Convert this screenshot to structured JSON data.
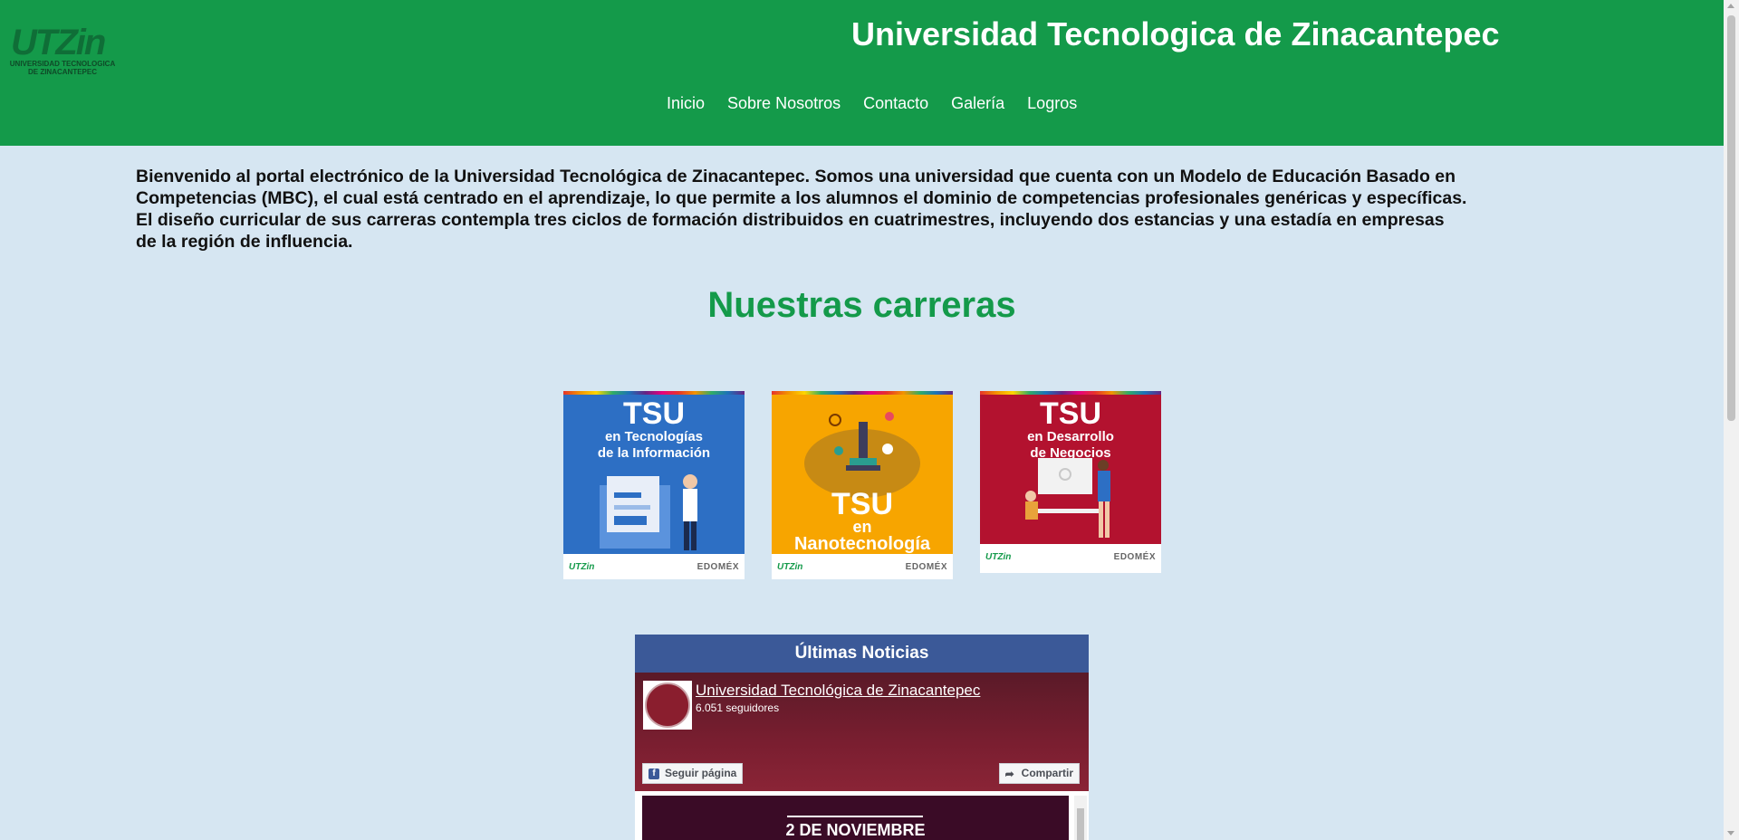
{
  "header": {
    "logo_text": "UTZin",
    "logo_subtitle": "UNIVERSIDAD TECNOLOGICA DE ZINACANTEPEC",
    "title": "Universidad Tecnologica de Zinacantepec",
    "nav": [
      "Inicio",
      "Sobre Nosotros",
      "Contacto",
      "Galería",
      "Logros"
    ]
  },
  "intro": "Bienvenido al portal electrónico de la Universidad Tecnológica de Zinacantepec. Somos una universidad que cuenta con un Modelo de Educación Basado en Competencias (MBC), el cual está centrado en el aprendizaje, lo que permite a los alumnos el dominio de competencias profesionales genéricas y específicas. El diseño curricular de sus carreras contempla tres ciclos de formación distribuidos en cuatrimestres, incluyendo dos estancias y una estadía en empresas de la región de influencia.",
  "careers": {
    "heading": "Nuestras carreras",
    "items": [
      {
        "tsu": "TSU",
        "line1": "en Tecnologías",
        "line2": "de la Información",
        "foot_left": "UTZin",
        "foot_right": "EDOMÉX"
      },
      {
        "tsu": "TSU",
        "line1": "en",
        "line2": "Nanotecnología",
        "foot_left": "UTZin",
        "foot_right": "EDOMÉX"
      },
      {
        "tsu": "TSU",
        "line1": "en Desarrollo",
        "line2": "de Negocios",
        "foot_left": "UTZin",
        "foot_right": "EDOMÉX"
      }
    ]
  },
  "news": {
    "title": "Últimas Noticias",
    "page_name": "Universidad Tecnológica de Zinacantepec",
    "followers": "6.051 seguidores",
    "follow_label": "Seguir página",
    "share_label": "Compartir",
    "post_text": "2 DE NOVIEMBRE"
  },
  "colors": {
    "header_green": "#149a4a",
    "page_bg": "#d6e6f2",
    "facebook_blue": "#3b5998"
  }
}
